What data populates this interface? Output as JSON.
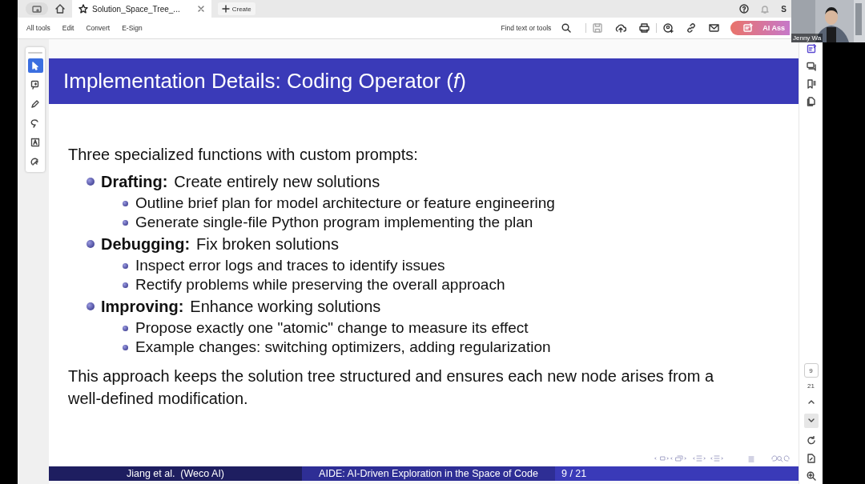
{
  "tab_strip": {
    "tabs": [
      {
        "label": "Solution_Space_Tree_...",
        "selected": true
      }
    ],
    "create_button": "Create",
    "avatar_letter": "S"
  },
  "toolbar": {
    "menu": [
      "All tools",
      "Edit",
      "Convert",
      "E-Sign"
    ],
    "search": "Find text or tools",
    "ai_button": "AI Ass"
  },
  "left_tools": [
    {
      "selected": true
    },
    {
      "selected": false
    },
    {
      "selected": false
    },
    {
      "selected": false
    },
    {
      "selected": false
    },
    {
      "selected": false
    }
  ],
  "slide": {
    "title": "Implementation Details: Coding Operator (*f*)",
    "intro": "Three specialized functions with custom prompts:",
    "sections": [
      {
        "heading": "Drafting:",
        "text": "Create entirely new solutions",
        "items": [
          "Outline brief plan for model architecture or feature engineering",
          "Generate single-file Python program implementing the plan"
        ]
      },
      {
        "heading": "Debugging:",
        "text": "Fix broken solutions",
        "items": [
          "Inspect error logs and traces to identify issues",
          "Rectify problems while preserving the overall approach"
        ]
      },
      {
        "heading": "Improving:",
        "text": "Enhance working solutions",
        "items": [
          "Propose exactly one \"atomic\" change to measure its effect",
          "Example changes: switching optimizers, adding regularization"
        ]
      }
    ],
    "conclusion": "This approach keeps the solution tree structured and ensures each new node arises from a well-defined modification.",
    "footer": {
      "authors": "Jiang et al.  (Weco AI)",
      "title": "AIDE: AI-Driven Exploration in the Space of Code",
      "page": "9 / 21"
    }
  },
  "page_nav": {
    "current": "9",
    "total": "21"
  },
  "video": {
    "name": "Jenny Wa"
  }
}
